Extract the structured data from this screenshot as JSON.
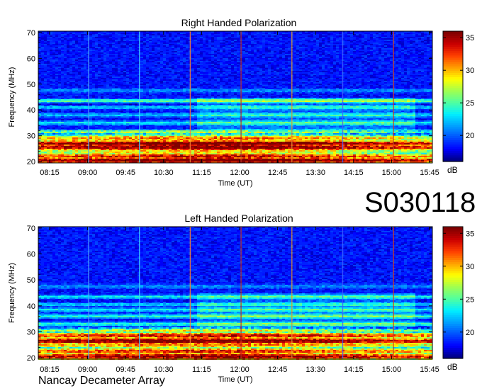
{
  "observation_id": "S030118",
  "instrument": "Nancay Decameter Array",
  "colors": {
    "colormap": [
      "#00007f",
      "#0000ff",
      "#0050ff",
      "#00a0ff",
      "#00f0ff",
      "#50ffa0",
      "#a0ff50",
      "#ffff00",
      "#ff9f00",
      "#ff3f00",
      "#cc0000",
      "#7f0000"
    ]
  },
  "chart_data": [
    {
      "type": "heatmap",
      "title": "Right Handed Polarization",
      "xlabel": "Time (UT)",
      "ylabel": "Frequency (MHz)",
      "x_ticks": [
        "08:15",
        "09:00",
        "09:45",
        "10:30",
        "11:15",
        "12:00",
        "12:45",
        "13:30",
        "14:15",
        "15:00",
        "15:45"
      ],
      "y_ticks": [
        20,
        30,
        40,
        50,
        60,
        70
      ],
      "ylim": [
        19.5,
        70.5
      ],
      "colorbar": {
        "label": "dB",
        "ticks": [
          20,
          25,
          30,
          35
        ],
        "range": [
          16,
          36
        ]
      },
      "emission_bands": [
        {
          "f": 20.5,
          "level": 36
        },
        {
          "f": 22.0,
          "level": 33
        },
        {
          "f": 24.0,
          "level": 28
        },
        {
          "f": 25.5,
          "level": 35
        },
        {
          "f": 27.0,
          "level": 36
        },
        {
          "f": 29.0,
          "level": 30
        },
        {
          "f": 31.5,
          "level": 26
        },
        {
          "f": 35.0,
          "level": 24
        },
        {
          "f": 38.0,
          "level": 23
        },
        {
          "f": 41.0,
          "level": 23
        },
        {
          "f": 43.5,
          "level": 26
        },
        {
          "f": 47.5,
          "level": 21
        }
      ]
    },
    {
      "type": "heatmap",
      "title": "Left Handed Polarization",
      "xlabel": "Time (UT)",
      "ylabel": "Frequency (MHz)",
      "x_ticks": [
        "08:15",
        "09:00",
        "09:45",
        "10:30",
        "11:15",
        "12:00",
        "12:45",
        "13:30",
        "14:15",
        "15:00",
        "15:45"
      ],
      "y_ticks": [
        20,
        30,
        40,
        50,
        60,
        70
      ],
      "ylim": [
        19.5,
        70.5
      ],
      "colorbar": {
        "label": "dB",
        "ticks": [
          20,
          25,
          30,
          35
        ],
        "range": [
          16,
          36
        ]
      },
      "emission_bands": [
        {
          "f": 20.5,
          "level": 35
        },
        {
          "f": 22.5,
          "level": 32
        },
        {
          "f": 25.0,
          "level": 30
        },
        {
          "f": 26.5,
          "level": 36
        },
        {
          "f": 28.5,
          "level": 33
        },
        {
          "f": 30.5,
          "level": 27
        },
        {
          "f": 33.0,
          "level": 25
        },
        {
          "f": 36.0,
          "level": 25
        },
        {
          "f": 38.5,
          "level": 24
        },
        {
          "f": 40.5,
          "level": 23
        },
        {
          "f": 43.5,
          "level": 24
        },
        {
          "f": 47.5,
          "level": 21
        }
      ]
    }
  ]
}
